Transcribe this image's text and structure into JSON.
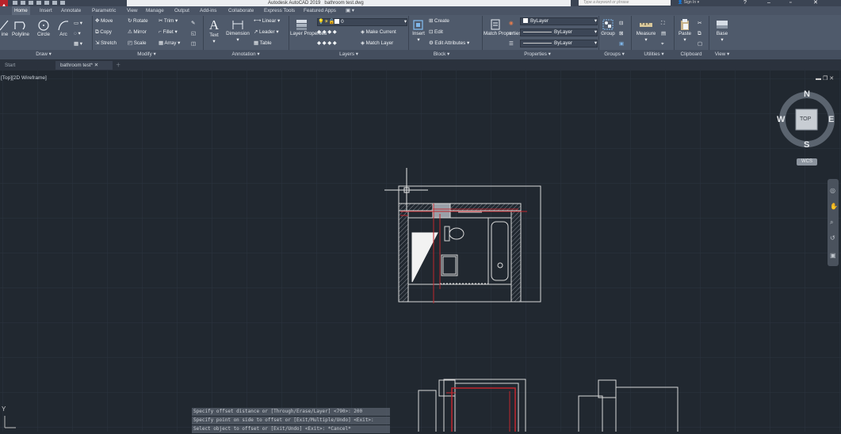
{
  "window": {
    "app_title": "Autodesk AutoCAD 2019",
    "file_title": "bathroom test.dwg",
    "search_placeholder": "Type a keyword or phrase",
    "sign_in": "Sign In"
  },
  "ribbon_tabs": [
    "Home",
    "Insert",
    "Annotate",
    "Parametric",
    "View",
    "Manage",
    "Output",
    "Add-ins",
    "Collaborate",
    "Express Tools",
    "Featured Apps"
  ],
  "active_tab": "Home",
  "draw": {
    "line": "ine",
    "polyline": "Polyline",
    "circle": "Circle",
    "arc": "Arc"
  },
  "modify": {
    "move": "Move",
    "rotate": "Rotate",
    "trim": "Trim",
    "copy": "Copy",
    "mirror": "Mirror",
    "fillet": "Fillet",
    "stretch": "Stretch",
    "scale": "Scale",
    "array": "Array"
  },
  "annotation": {
    "text": "Text",
    "dimension": "Dimension",
    "linear": "Linear",
    "leader": "Leader",
    "table": "Table"
  },
  "layers": {
    "layer_properties": "Layer Properties",
    "current_layer": "0",
    "make_current": "Make Current",
    "match_layer": "Match Layer"
  },
  "block": {
    "insert": "Insert",
    "create": "Create",
    "edit": "Edit",
    "edit_attributes": "Edit Attributes"
  },
  "properties": {
    "match_properties": "Match Properties",
    "color": "ByLayer",
    "linetype": "ByLayer",
    "lineweight": "ByLayer"
  },
  "groups": {
    "group": "Group"
  },
  "utilities": {
    "measure": "Measure"
  },
  "clipboard": {
    "paste": "Paste"
  },
  "view_panel": {
    "base": "Base"
  },
  "panel_titles": {
    "draw": "Draw ▾",
    "modify": "Modify ▾",
    "annotation": "Annotation ▾",
    "layers": "Layers ▾",
    "block": "Block ▾",
    "properties": "Properties ▾",
    "groups": "Groups ▾",
    "utilities": "Utilities ▾",
    "clipboard": "Clipboard",
    "view": "View ▾"
  },
  "file_tabs": [
    "Start",
    "bathroom test*"
  ],
  "viewport_label": "[Top][2D Wireframe]",
  "viewcube": {
    "n": "N",
    "s": "S",
    "e": "E",
    "w": "W",
    "top": "TOP",
    "wcs": "WCS"
  },
  "command_history": [
    "Specify offset distance or [Through/Erase/Layer] <790>: 200",
    "Specify point on side to offset or [Exit/Multiple/Undo] <Exit>:",
    "Select object to offset or [Exit/Undo] <Exit>: *Cancel*"
  ],
  "ucs_y": "Y",
  "colors": {
    "canvas": "#212830",
    "ribbon": "#4f5a6b",
    "accent_red": "#c0262d",
    "wall": "#dcdcdc"
  }
}
